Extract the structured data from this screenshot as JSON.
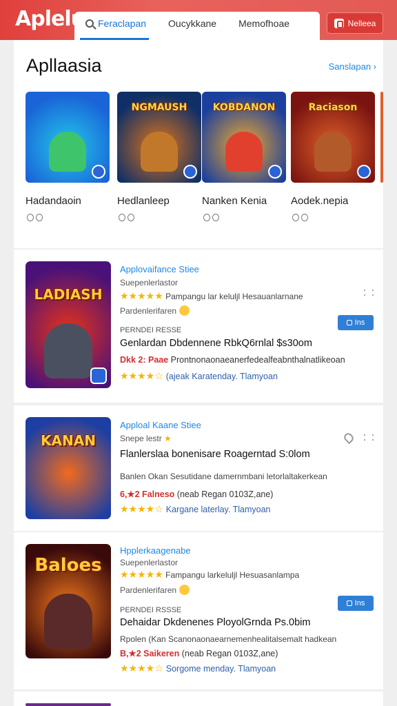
{
  "app": {
    "logo": "Aplelu"
  },
  "tabs": [
    {
      "label": "Feraclapan"
    },
    {
      "label": "Oucykkane"
    },
    {
      "label": "Memofhoae"
    }
  ],
  "top_button": {
    "label": "Nelleea"
  },
  "featured": {
    "title": "Apllaasia",
    "link": "Sanslapan ›",
    "items": [
      {
        "name": "Hadandaoin",
        "art": "",
        "colors": [
          "#1a64d8",
          "#22c7ea"
        ]
      },
      {
        "name": "Hedlanleep",
        "art": "NGMAUSH",
        "colors": [
          "#0f2f66",
          "#e0741a"
        ]
      },
      {
        "name": "Nanken Kenia",
        "art": "KOBDANON",
        "colors": [
          "#1a3f9e",
          "#f1a92c"
        ]
      },
      {
        "name": "Aodek.nepia",
        "art": "Raciason",
        "colors": [
          "#7a1410",
          "#e0602a"
        ]
      }
    ]
  },
  "cards": [
    {
      "app_name": "Applovaifance Stiee",
      "developer": "Suepenlerlastor",
      "rating_text": "Pampangu lar keluljl Hesauanlarnane",
      "sub": "Pardenlerifaren",
      "tag": "PERNDEI RESSE",
      "headline": "Genlardan Dbdennene RbkQ6rnlal $s30om",
      "red_label": "Dkk 2: Paae",
      "red_text": "Prontnonaonaeanerfedealfeabnthalnatlikeoan",
      "foot": "(ajeak Karatenday. Tlamyoan",
      "install": "Ins",
      "art": "LADIASH",
      "colors": [
        "#4a1278",
        "#e6321a"
      ]
    },
    {
      "app_name": "Apploal Kaane Stiee",
      "developer": "Snepe lestr",
      "headline": "Flanlerslaa bonenisare Roagerntad S:0lom",
      "sub": "Banlen Okan Sesutidane damernmbani letorlaltakerkean",
      "red_label": "6,★2 Falneso",
      "red_text": "(neab Regan 0103Z,ane)",
      "foot": "Kargane laterlay. Tlamyoan",
      "art": "KANAN",
      "colors": [
        "#1d3fa3",
        "#f26a1e"
      ]
    },
    {
      "app_name": "Hpplerkaagenabe",
      "developer": "Suepenlerlastor",
      "rating_text": "Fampangu larkeluljl Hesuasanlampa",
      "sub": "Pardenlerifaren",
      "tag": "PERNDEI RSSSE",
      "headline": "Dehaidar Dkdenenes PloyolGrnda Ps.0bim",
      "line2": "Rpolen (Kan Scanonaonaearnemenhealitalsemalt hadkean",
      "red_label": "B,★2 Saikeren",
      "red_text": "(neab Regan 0103Z,ane)",
      "foot": "Sorgome menday. Tlamyoan",
      "install": "Ins",
      "art": "Baloes",
      "colors": [
        "#3a0a0a",
        "#f0761e"
      ]
    }
  ]
}
